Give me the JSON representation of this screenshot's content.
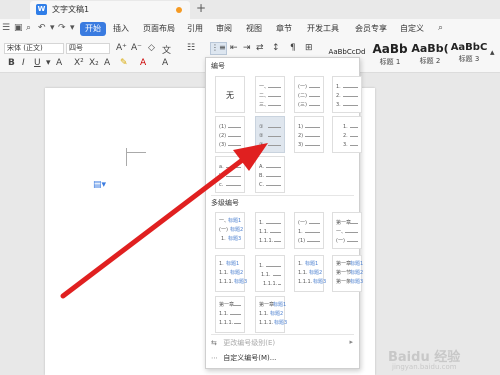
{
  "tab": {
    "doc_title": "文字文稿1",
    "new_tab": "+"
  },
  "menu": {
    "items": [
      "开始",
      "插入",
      "页面布局",
      "引用",
      "审阅",
      "视图",
      "章节",
      "开发工具",
      "会员专享",
      "自定义"
    ]
  },
  "toolbar": {
    "font_name": "宋体 (正文)",
    "font_size": "四号",
    "styles": [
      {
        "sample": "AaBbCcDd",
        "label": ""
      },
      {
        "sample": "AaBb",
        "label": "标题 1"
      },
      {
        "sample": "AaBb(",
        "label": "标题 2"
      },
      {
        "sample": "AaBbC",
        "label": "标题 3"
      }
    ]
  },
  "panel": {
    "section_numbering": "编号",
    "none_label": "无",
    "section_multilevel": "多级编号",
    "footer": {
      "change_level": "更改编号级别(E)",
      "custom": "自定义编号(M)..."
    }
  },
  "watermark": {
    "brand": "Baidu 经验",
    "url": "jingyan.baidu.com"
  },
  "colors": {
    "accent": "#3a7be0",
    "arrow": "#e02020",
    "panel_selected": "#dfe6ee"
  }
}
